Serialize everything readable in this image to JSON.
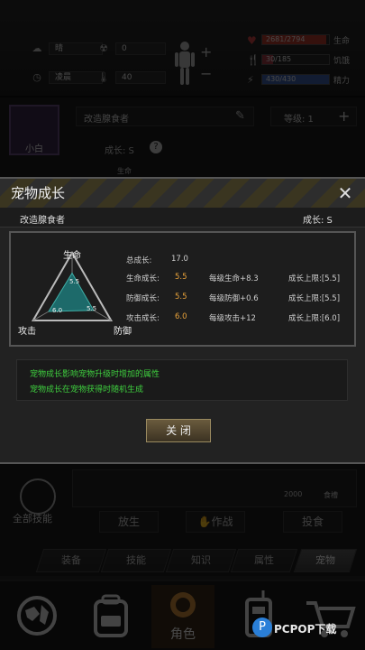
{
  "top": {
    "stat1_value": "晴",
    "stat2_value": "0",
    "stat3_value": "凌晨",
    "stat4_value": "40",
    "hp": {
      "label": "生命",
      "value": "2681/2794",
      "fill": 0.96,
      "color": "#b23a2c"
    },
    "hunger": {
      "label": "饥饿",
      "value": "30/185",
      "fill": 0.16,
      "color": "#9c3a46"
    },
    "energy": {
      "label": "精力",
      "value": "430/430",
      "fill": 1.0,
      "color": "#3e5fa6"
    },
    "plus": "+",
    "minus": "−"
  },
  "pet_panel": {
    "pet_name": "小白",
    "pet_title": "改造腺食者",
    "growth": "成长: S",
    "level": "等级: 1",
    "life_small": "生命",
    "food_count": "2000",
    "food_label": "食槽",
    "all_skills": "全部技能",
    "release": "放生",
    "battle": "作战",
    "feed": "投食"
  },
  "tabs": [
    "装备",
    "技能",
    "知识",
    "属性",
    "宠物"
  ],
  "active_tab": "宠物",
  "nav": [
    "map-icon",
    "backpack-icon",
    "character-icon",
    "radio-icon",
    "cart-icon"
  ],
  "nav_center_label": "角色",
  "watermark": "PCPOP下载",
  "modal": {
    "title": "宠物成长",
    "close": "✕",
    "pet_name": "改造腺食者",
    "growth": "成长: S",
    "radar": {
      "top_label": "生命",
      "left_label": "攻击",
      "right_label": "防御",
      "values": [
        5.5,
        5.5,
        6.0
      ],
      "max": 10,
      "val_top": "5.5",
      "val_left": "6.0",
      "val_right": "5.5"
    },
    "stats": {
      "total_label": "总成长:",
      "total_value": "17.0",
      "rows": [
        {
          "label": "生命成长:",
          "value": "5.5",
          "per": "每级生命+8.3",
          "cap": "成长上限:[5.5]"
        },
        {
          "label": "防御成长:",
          "value": "5.5",
          "per": "每级防御+0.6",
          "cap": "成长上限:[5.5]"
        },
        {
          "label": "攻击成长:",
          "value": "6.0",
          "per": "每级攻击+12",
          "cap": "成长上限:[6.0]"
        }
      ]
    },
    "desc": [
      "宠物成长影响宠物升级时增加的属性",
      "宠物成长在宠物获得时随机生成"
    ],
    "close_button": "关 闭"
  }
}
